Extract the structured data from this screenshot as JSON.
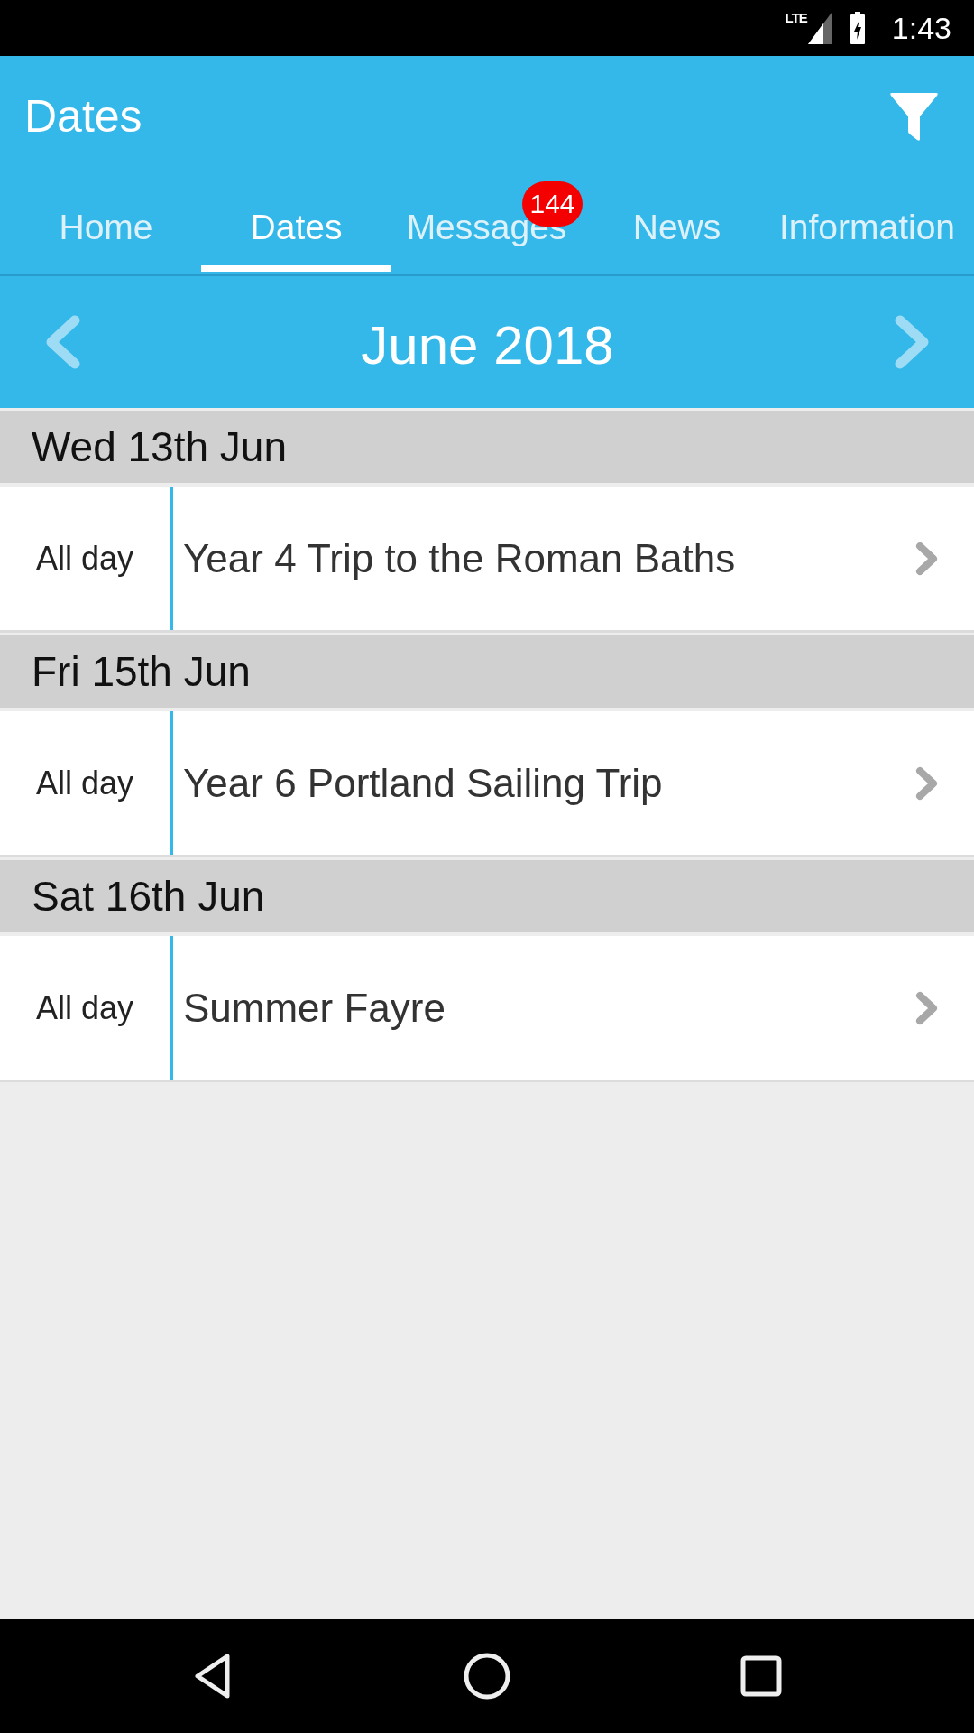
{
  "status_bar": {
    "network": "LTE",
    "time": "1:43"
  },
  "app_bar": {
    "title": "Dates"
  },
  "tabs": [
    {
      "label": "Home",
      "selected": false
    },
    {
      "label": "Dates",
      "selected": true
    },
    {
      "label": "Messages",
      "selected": false,
      "badge": "144"
    },
    {
      "label": "News",
      "selected": false
    },
    {
      "label": "Information",
      "selected": false
    }
  ],
  "month_nav": {
    "title": "June 2018"
  },
  "days": [
    {
      "date": "Wed 13th Jun",
      "events": [
        {
          "time": "All day",
          "title": "Year 4 Trip to the Roman Baths"
        }
      ]
    },
    {
      "date": "Fri 15th Jun",
      "events": [
        {
          "time": "All day",
          "title": "Year 6 Portland Sailing Trip"
        }
      ]
    },
    {
      "date": "Sat 16th Jun",
      "events": [
        {
          "time": "All day",
          "title": "Summer Fayre"
        }
      ]
    }
  ]
}
